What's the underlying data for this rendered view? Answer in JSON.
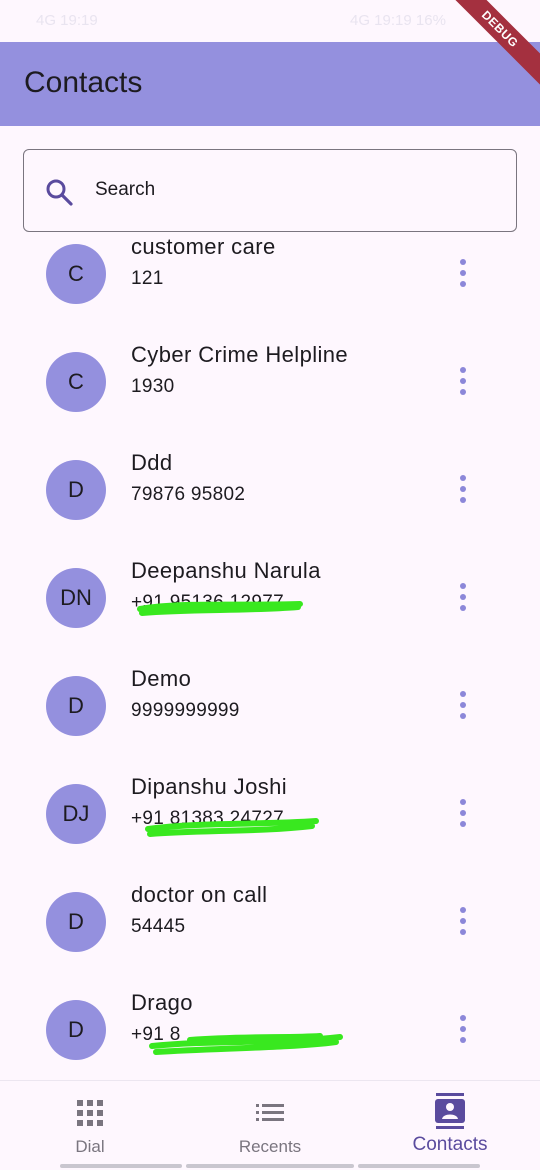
{
  "status_bar": {
    "time": "4G 19:19",
    "right": "4G 19:19  16%"
  },
  "debug_label": "DEBUG",
  "app_bar": {
    "title": "Contacts"
  },
  "search": {
    "placeholder": "Search",
    "icon": "search-icon"
  },
  "contacts": [
    {
      "initials": "C",
      "name": "customer care",
      "phone": "121",
      "phone_obscured": false
    },
    {
      "initials": "C",
      "name": "Cyber Crime Helpline",
      "phone": "1930",
      "phone_obscured": false
    },
    {
      "initials": "D",
      "name": "Ddd",
      "phone": "79876 95802",
      "phone_obscured": false
    },
    {
      "initials": "DN",
      "name": "Deepanshu Narula",
      "phone": "+91 95136 12977",
      "phone_obscured": true
    },
    {
      "initials": "D",
      "name": "Demo",
      "phone": "9999999999",
      "phone_obscured": false
    },
    {
      "initials": "DJ",
      "name": "Dipanshu Joshi",
      "phone": "+91 81383 24727",
      "phone_obscured": true
    },
    {
      "initials": "D",
      "name": "doctor on call",
      "phone": "54445",
      "phone_obscured": false
    },
    {
      "initials": "D",
      "name": "Drago",
      "phone": "+91 8",
      "phone_obscured": true
    }
  ],
  "bottom_nav": {
    "items": [
      {
        "label": "Dial",
        "icon": "dialpad-icon",
        "active": false
      },
      {
        "label": "Recents",
        "icon": "list-icon",
        "active": false
      },
      {
        "label": "Contacts",
        "icon": "contacts-icon",
        "active": true
      }
    ]
  },
  "colors": {
    "app_bar": "#9490DE",
    "avatar": "#9490DE",
    "background": "#FEF7FE",
    "accent": "#5A4B9E",
    "scribble": "#39E81F"
  }
}
